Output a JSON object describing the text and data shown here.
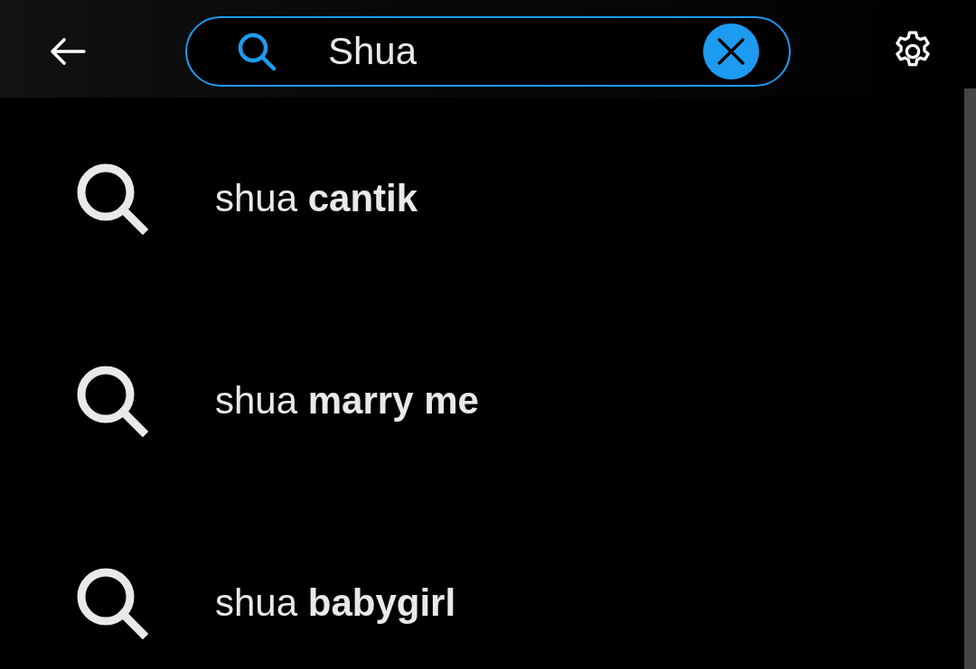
{
  "search_bar": {
    "value": "Shua"
  },
  "suggestions": [
    {
      "text": "shua **cantik**"
    },
    {
      "text": "shua **marry me**"
    },
    {
      "text": "shua **babygirl**"
    }
  ]
}
